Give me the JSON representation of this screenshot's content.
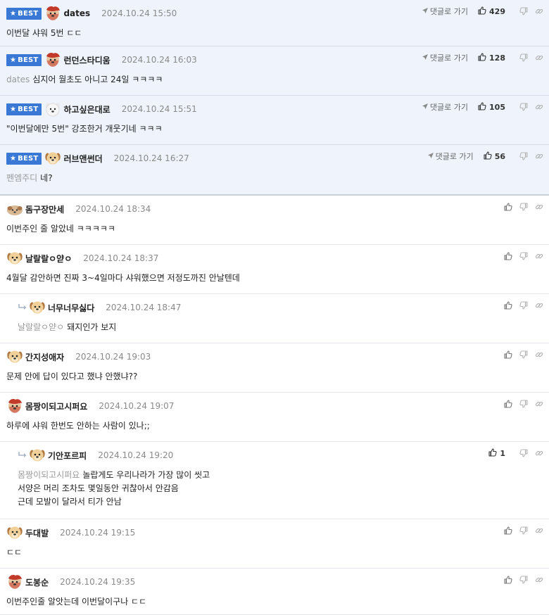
{
  "labels": {
    "best": "BEST",
    "goto": "댓글로 가기"
  },
  "colors": {
    "best_badge": "#3a78d6",
    "best_row_bg": "#eef3fc",
    "mention": "#9a9a9a"
  },
  "comments": [
    {
      "best": true,
      "reply": false,
      "avatar": "red-dog-avatar",
      "nick": "dates",
      "date": "2024.10.24 15:50",
      "mention": "",
      "lines": [
        "이번달 샤워 5번 ㄷㄷ"
      ],
      "likes": "429"
    },
    {
      "best": true,
      "reply": false,
      "avatar": "red-dog-avatar",
      "nick": "런던스타디움",
      "date": "2024.10.24 16:03",
      "mention": "dates",
      "lines": [
        "심지어 월초도 아니고 24일 ㅋㅋㅋㅋ"
      ],
      "likes": "128"
    },
    {
      "best": true,
      "reply": false,
      "avatar": "white-dog-avatar",
      "nick": "하고싶은대로",
      "date": "2024.10.24 15:51",
      "mention": "",
      "lines": [
        "\"이번달에만 5번\" 강조한거 개웃기네 ㅋㅋㅋ"
      ],
      "likes": "105"
    },
    {
      "best": true,
      "reply": false,
      "avatar": "puppy-avatar",
      "nick": "러브앤썬더",
      "date": "2024.10.24 16:27",
      "mention": "펜엠주디",
      "lines": [
        "네?"
      ],
      "likes": "56"
    },
    {
      "best": false,
      "reply": false,
      "avatar": "small-dog-avatar",
      "nick": "돔구장만세",
      "date": "2024.10.24 18:34",
      "mention": "",
      "lines": [
        "이번주인 줄 알았네 ㅋㅋㅋㅋㅋ"
      ],
      "likes": ""
    },
    {
      "best": false,
      "reply": false,
      "avatar": "puppy-avatar",
      "nick": "날랄랄ㅇ얃ㅇ",
      "date": "2024.10.24 18:37",
      "mention": "",
      "lines": [
        "4월달 감안하면 진짜 3~4일마다 샤워했으면 저정도까진 안날텐데"
      ],
      "likes": ""
    },
    {
      "best": false,
      "reply": true,
      "avatar": "puppy-avatar",
      "nick": "너무너무싫다",
      "date": "2024.10.24 18:47",
      "mention": "날랄랄ㅇ얃ㅇ",
      "lines": [
        "돼지인가 보지"
      ],
      "likes": ""
    },
    {
      "best": false,
      "reply": false,
      "avatar": "puppy-avatar",
      "nick": "간지성애자",
      "date": "2024.10.24 19:03",
      "mention": "",
      "lines": [
        "문제 안에 답이 있다고 했냐 안했냐??"
      ],
      "likes": ""
    },
    {
      "best": false,
      "reply": false,
      "avatar": "red-dog-avatar",
      "nick": "몸짱이되고시퍼요",
      "date": "2024.10.24 19:07",
      "mention": "",
      "lines": [
        "하루에 샤워 한번도 안하는 사람이 있나;;"
      ],
      "likes": ""
    },
    {
      "best": false,
      "reply": true,
      "avatar": "puppy-avatar",
      "nick": "기안포르피",
      "date": "2024.10.24 19:20",
      "mention": "몸짱이되고시퍼요",
      "lines": [
        "놀랍게도 우리나라가 가장 많이 씻고",
        "서양은 머리 조차도 몇일동안 귀찮아서 안감음",
        "근데 모발이 달라서 티가 안남"
      ],
      "likes": "1"
    },
    {
      "best": false,
      "reply": false,
      "avatar": "puppy-avatar",
      "nick": "두대발",
      "date": "2024.10.24 19:15",
      "mention": "",
      "lines": [
        "ㄷㄷ"
      ],
      "likes": ""
    },
    {
      "best": false,
      "reply": false,
      "avatar": "red-dog-avatar",
      "nick": "도봉순",
      "date": "2024.10.24 19:35",
      "mention": "",
      "lines": [
        "이번주인줄 알앗는데 이번달이구나 ㄷㄷ"
      ],
      "likes": ""
    }
  ]
}
